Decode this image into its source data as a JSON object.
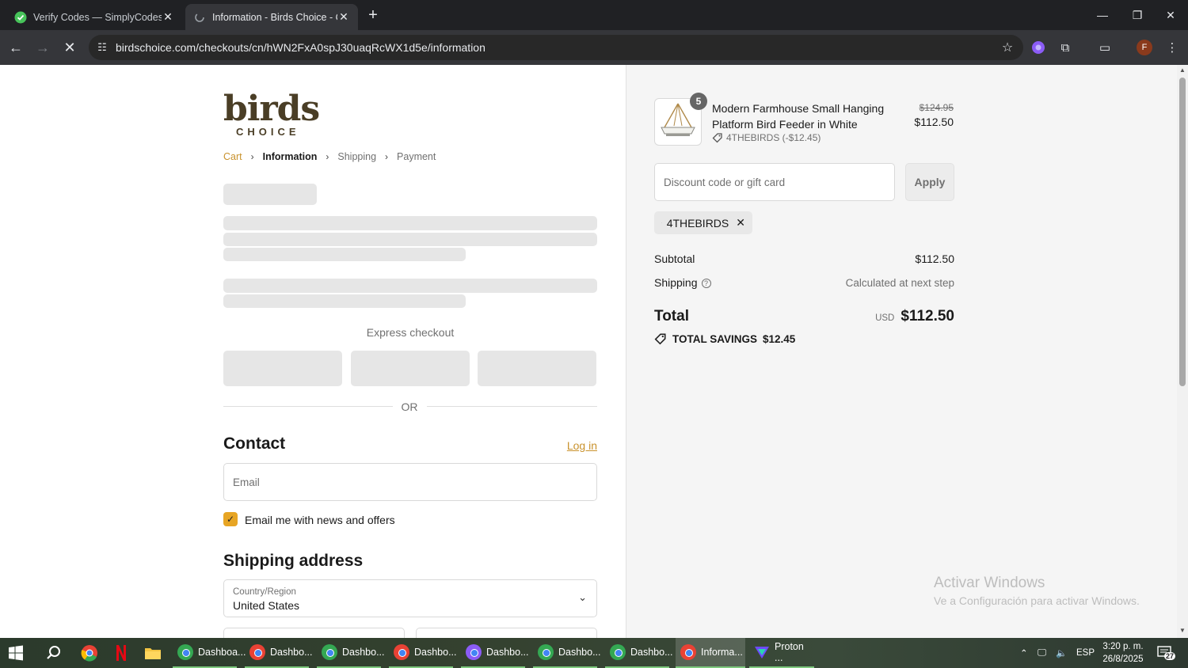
{
  "browser": {
    "tabs": [
      {
        "title": "Verify Codes — SimplyCodes",
        "active": false
      },
      {
        "title": "Information - Birds Choice - Ch",
        "active": true
      }
    ],
    "url": "birdschoice.com/checkouts/cn/hWN2FxA0spJ30uaqRcWX1d5e/information",
    "profile_initial": "F"
  },
  "store": {
    "logo_main": "birds",
    "logo_sub": "CHOICE"
  },
  "breadcrumb": {
    "cart": "Cart",
    "information": "Information",
    "shipping": "Shipping",
    "payment": "Payment"
  },
  "checkout": {
    "express_checkout": "Express checkout",
    "or": "OR",
    "contact_title": "Contact",
    "login_link": "Log in",
    "email_placeholder": "Email",
    "newsletter_label": "Email me with news and offers",
    "newsletter_checked": true,
    "shipping_title": "Shipping address",
    "country_label": "Country/Region",
    "country_value": "United States"
  },
  "summary": {
    "item": {
      "quantity": "5",
      "name": "Modern Farmhouse Small Hanging Platform Bird Feeder in White",
      "discount_line": "4THEBIRDS (-$12.45)",
      "original_price": "$124.95",
      "price": "$112.50"
    },
    "discount_placeholder": "Discount code or gift card",
    "apply_label": "Apply",
    "applied_code": "4THEBIRDS",
    "subtotal_label": "Subtotal",
    "subtotal_value": "$112.50",
    "shipping_label": "Shipping",
    "shipping_value": "Calculated at next step",
    "total_label": "Total",
    "currency": "USD",
    "total_value": "$112.50",
    "savings_label": "TOTAL SAVINGS",
    "savings_value": "$12.45"
  },
  "watermark": {
    "line1": "Activar Windows",
    "line2": "Ve a Configuración para activar Windows."
  },
  "taskbar": {
    "apps": [
      {
        "label": "Dashboa...",
        "active": false
      },
      {
        "label": "Dashbo...",
        "active": false
      },
      {
        "label": "Dashbo...",
        "active": false
      },
      {
        "label": "Dashbo...",
        "active": false
      },
      {
        "label": "Dashbo...",
        "active": false
      },
      {
        "label": "Dashbo...",
        "active": false
      },
      {
        "label": "Dashbo...",
        "active": false
      },
      {
        "label": "Informa...",
        "active": true
      },
      {
        "label": "Proton ...",
        "active": false
      }
    ],
    "language": "ESP",
    "time": "3:20 p. m.",
    "date": "26/8/2025",
    "notification_count": "27"
  },
  "colors": {
    "accent": "#c9922d",
    "checkbox": "#e7a524",
    "logo": "#4a3e26"
  }
}
